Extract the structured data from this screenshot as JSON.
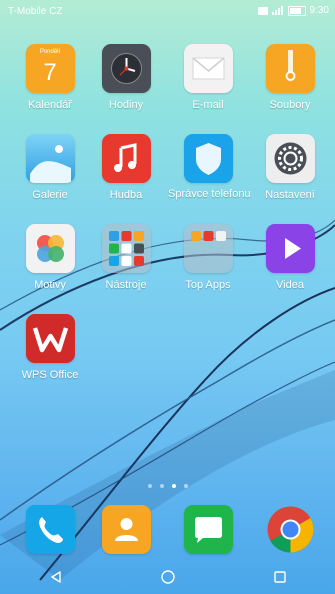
{
  "status_bar": {
    "carrier": "T-Mobile CZ",
    "time": "9:30"
  },
  "apps": [
    {
      "label": "Kalendář",
      "icon": "calendar-icon",
      "day_name": "Pondělí",
      "day": "7"
    },
    {
      "label": "Hodiny",
      "icon": "clock-icon"
    },
    {
      "label": "E-mail",
      "icon": "envelope-icon"
    },
    {
      "label": "Soubory",
      "icon": "folder-zip-icon"
    },
    {
      "label": "Galerie",
      "icon": "gallery-icon"
    },
    {
      "label": "Hudba",
      "icon": "music-note-icon"
    },
    {
      "label": "Správce telefonu",
      "icon": "shield-icon"
    },
    {
      "label": "Nastavení",
      "icon": "gear-icon"
    },
    {
      "label": "Motivy",
      "icon": "themes-icon"
    },
    {
      "label": "Nástroje",
      "icon": "folder-icon"
    },
    {
      "label": "Top Apps",
      "icon": "folder-icon"
    },
    {
      "label": "Videa",
      "icon": "play-icon"
    },
    {
      "label": "WPS Office",
      "icon": "wps-office-icon"
    }
  ],
  "dock": [
    {
      "name": "phone",
      "icon": "phone-icon"
    },
    {
      "name": "contacts",
      "icon": "contacts-icon"
    },
    {
      "name": "messages",
      "icon": "message-icon"
    },
    {
      "name": "chrome",
      "icon": "chrome-icon"
    }
  ],
  "page_indicator": {
    "pages": 4,
    "current": 3
  },
  "colors": {
    "calendar": "#f7a623",
    "clock": "#4a4f57",
    "email": "#f2f2f2",
    "files": "#f7a623",
    "gallery": "#2d9fe5",
    "music": "#e8392f",
    "shield": "#1aa3e8",
    "settings": "#6b7075",
    "videos": "#8a43e6",
    "wps": "#d12a2a",
    "phone": "#14a6e6",
    "contacts": "#f7a623",
    "messages": "#20b54a"
  }
}
